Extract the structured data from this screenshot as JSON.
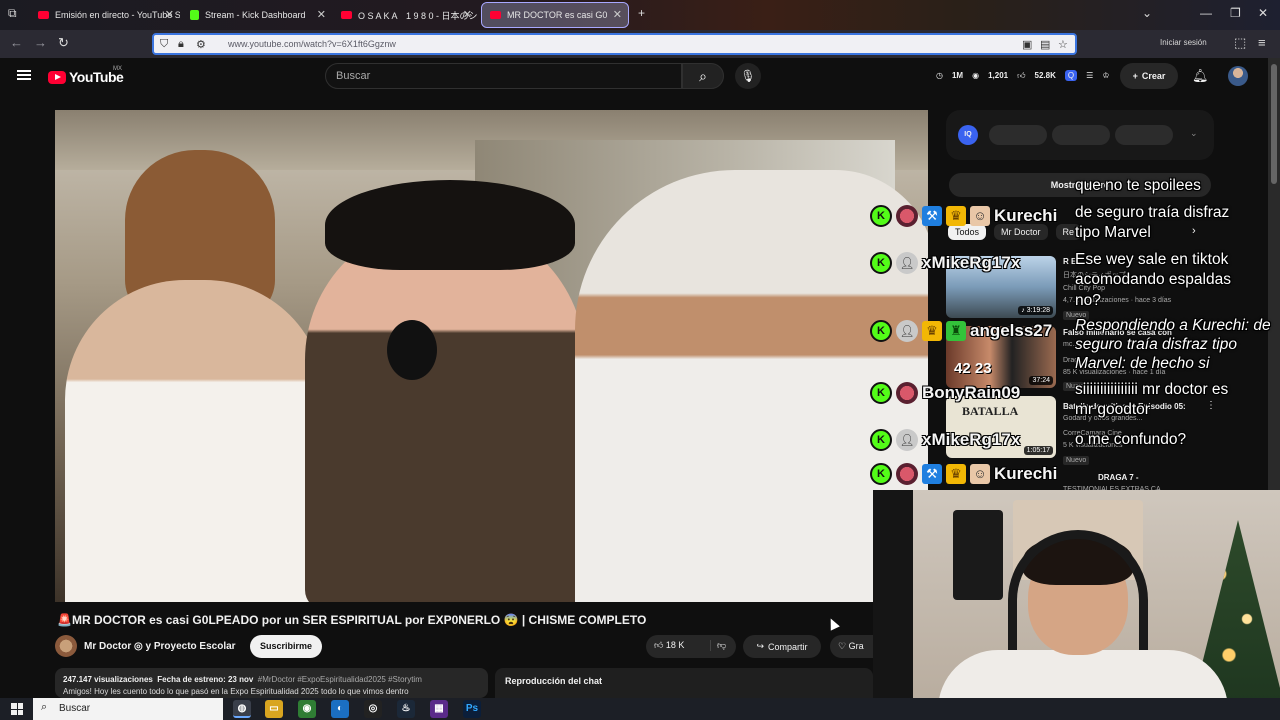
{
  "browser": {
    "tabs": [
      {
        "title": "Emisión en directo - YouTube S",
        "favicon": "youtube-icon",
        "active": false
      },
      {
        "title": "Stream - Kick Dashboard",
        "favicon": "kick-icon",
        "active": false
      },
      {
        "title": "O S A K A　1 9 8 0 - 日本のシ",
        "favicon": "youtube-icon",
        "active": false
      },
      {
        "title": "MR DOCTOR es casi G0",
        "favicon": "youtube-icon",
        "active": true
      }
    ],
    "url": "www.youtube.com/watch?v=6X1ft6Ggznw",
    "signin_label": "Iniciar sesión"
  },
  "youtube": {
    "logo_text": "YouTube",
    "country_code": "MX",
    "search_placeholder": "Buscar",
    "stats": {
      "a": "1M",
      "b": "1,201",
      "c": "52.8K"
    },
    "create_label": "Crear"
  },
  "video": {
    "title": "MR DOCTOR es casi G0LPEADO por un SER ESPIRITUAL por EXP0NERLO 😨 | CHISME COMPLETO",
    "title_prefix_icon": "🚨",
    "channel": "Mr Doctor ◎ y Proyecto Escolar",
    "subscribe_label": "Suscribirme",
    "likes": "18 K",
    "share_label": "Compartir",
    "extra_label": "Gra",
    "views": "247.147 visualizaciones",
    "premiere": "Fecha de estreno: 23 nov",
    "hashtags": "#MrDoctor #ExpoEspiritualidad2025 #Storytim",
    "desc_line2": "Amigos! Hoy les cuento todo lo que pasó en la Expo Espiritualidad 2025 todo lo que vimos dentro",
    "chat_replay_label": "Reproducción del chat"
  },
  "sidebar": {
    "show_replay": "Mostrar repro",
    "chips": [
      "Todos",
      "Mr Doctor",
      "Re"
    ],
    "items": [
      {
        "duration": "3:19:28",
        "line1": "R E",
        "line2": "日本のシティポップ",
        "channel": "Chill City Pop",
        "stats": "4,7… visualizaciones · hace 3 días",
        "badge": "Nuevo"
      },
      {
        "duration": "37:24",
        "line1": "Falso millonario se casa con",
        "line2": "mc...",
        "channel": "Drag...",
        "stats": "85 K visualizaciones · hace 1 día",
        "badge": "Nuevo",
        "numbers": "42 23"
      },
      {
        "duration": "1:05:17",
        "line1": "Batalla de críticas - Episodio 05:",
        "line2": "Godard y otros grandes...",
        "channel": "CorreCamara Cine",
        "stats": "5 K visualizaciones",
        "badge": "Nuevo",
        "thumb_text": "BATALLA"
      },
      {
        "line1": "DRAGA 7 -",
        "line2": "TESTIMONIALES EXTRAS CA..."
      }
    ]
  },
  "chat": [
    {
      "user": "Kurechi",
      "badges": [
        "blue-hammer-icon",
        "gold-crown-icon",
        "face-emote-icon"
      ],
      "avatar": "red"
    },
    {
      "user": "xMikeRg17x",
      "badges": [],
      "avatar": "grey"
    },
    {
      "user": "angelss27",
      "badges": [
        "gold-crown-icon",
        "green-badge-icon"
      ],
      "avatar": "grey"
    },
    {
      "user": "BonyRain09",
      "badges": [],
      "avatar": "red"
    },
    {
      "user": "xMikeRg17x",
      "badges": [],
      "avatar": "grey"
    },
    {
      "user": "Kurechi",
      "badges": [
        "blue-hammer-icon",
        "gold-crown-icon",
        "face-emote-icon"
      ],
      "avatar": "red"
    }
  ],
  "chat_messages": [
    "que no te spoilees",
    "de seguro traía disfraz",
    "tipo Marvel",
    "Ese wey sale en tiktok",
    "acomodando espaldas",
    "no?",
    "Respondiendo a Kurechi: de",
    "seguro traía disfraz tipo",
    "Marvel: de hecho si",
    "siiiiiiiiiiiiiiii mr doctor es",
    "mr goodtor",
    "o me confundo?"
  ],
  "taskbar": {
    "search_label": "Buscar"
  },
  "colors": {
    "youtube_red": "#ff0033",
    "kick_green": "#53fc18",
    "accent_blue": "#3b75e0"
  }
}
